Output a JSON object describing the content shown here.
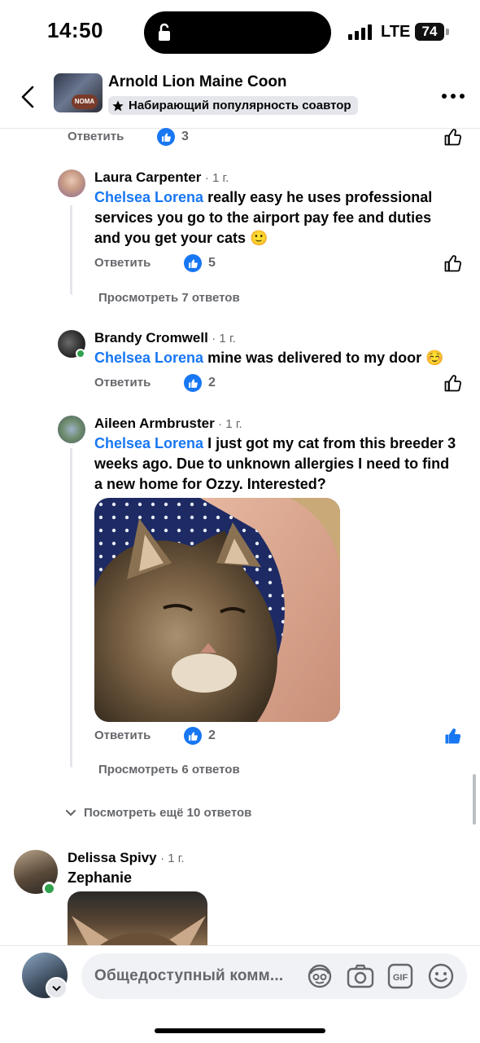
{
  "status_bar": {
    "time": "14:50",
    "network": "LTE",
    "battery": "74"
  },
  "header": {
    "title": "Arnold Lion Maine Coon",
    "badge": "Набирающий популярность соавтор",
    "avatar_text": "NOMA"
  },
  "comments": {
    "top_row": {
      "reply": "Ответить",
      "likes": "3"
    },
    "c1": {
      "name": "Laura Carpenter",
      "time": "· 1 г.",
      "mention": "Chelsea Lorena",
      "text_line1": " really easy he uses professional",
      "text_line2": "services you go to the airport pay fee and duties",
      "text_line3": "and you get your cats 🙂",
      "reply": "Ответить",
      "likes": "5",
      "view_replies": "Просмотреть 7 ответов"
    },
    "c2": {
      "name": "Brandy Cromwell",
      "time": "· 1 г.",
      "mention": "Chelsea Lorena",
      "text": " mine was delivered to my door ☺️",
      "reply": "Ответить",
      "likes": "2"
    },
    "c3": {
      "name": "Aileen Armbruster",
      "time": "· 1 г.",
      "mention": "Chelsea Lorena",
      "text_line1": " I just got my cat from this breeder 3",
      "text_line2": "weeks ago.  Due to unknown allergies I need to find",
      "text_line3": "a new home for Ozzy. Interested?",
      "reply": "Ответить",
      "likes": "2",
      "view_replies": "Просмотреть 6 ответов"
    },
    "more_replies": "Посмотреть ещё 10 ответов",
    "c4": {
      "name": "Delissa Spivy",
      "time": "· 1 г.",
      "text": "Zephanie"
    }
  },
  "composer": {
    "placeholder": "Общедоступный комм..."
  },
  "colors": {
    "accent": "#1877f2",
    "secondary_text": "#65676b",
    "online": "#31a24c"
  }
}
